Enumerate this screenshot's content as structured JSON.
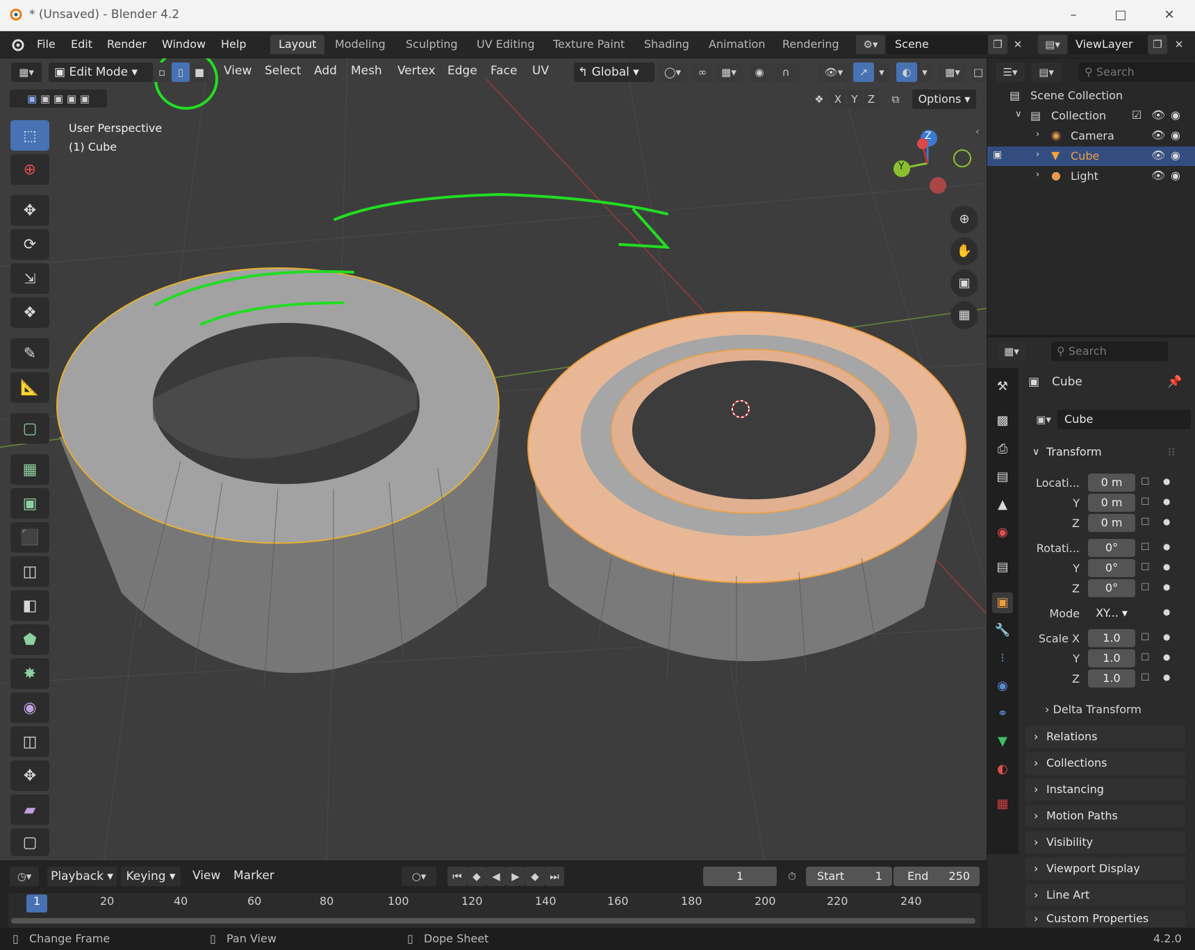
{
  "window": {
    "title": "* (Unsaved) - Blender 4.2",
    "minimize_icon": "minimize-icon",
    "maximize_icon": "maximize-icon",
    "close_icon": "close-icon"
  },
  "topbar": {
    "menus": [
      "File",
      "Edit",
      "Render",
      "Window",
      "Help"
    ],
    "workspaces": [
      "Layout",
      "Modeling",
      "Sculpting",
      "UV Editing",
      "Texture Paint",
      "Shading",
      "Animation",
      "Rendering"
    ],
    "active_workspace": "Layout",
    "scene": "Scene",
    "view_layer": "ViewLayer"
  },
  "viewport": {
    "mode": "Edit Mode",
    "menus": [
      "View",
      "Select",
      "Add",
      "Mesh",
      "Vertex",
      "Edge",
      "Face",
      "UV"
    ],
    "orientation": "Global",
    "axes": [
      "X",
      "Y",
      "Z"
    ],
    "options_label": "Options",
    "overlay_title": "User Perspective",
    "overlay_object": "(1) Cube",
    "gizmo": {
      "z": "Z",
      "y": "Y"
    }
  },
  "outliner": {
    "search_placeholder": "Search",
    "root": "Scene Collection",
    "collection": "Collection",
    "items": [
      "Camera",
      "Cube",
      "Light"
    ],
    "selected": "Cube"
  },
  "properties": {
    "search_placeholder": "Search",
    "object_name": "Cube",
    "datablock": "Cube",
    "transform_header": "Transform",
    "location_label": "Locati...",
    "location": [
      "0 m",
      "0 m",
      "0 m"
    ],
    "rotation_label": "Rotati...",
    "rotation": [
      "0°",
      "0°",
      "0°"
    ],
    "mode_label": "Mode",
    "mode_value": "XY...",
    "scale_label": "Scale X",
    "scale": [
      "1.0",
      "1.0",
      "1.0"
    ],
    "axis_y": "Y",
    "axis_z": "Z",
    "delta_transform": "Delta Transform",
    "panels": [
      "Relations",
      "Collections",
      "Instancing",
      "Motion Paths",
      "Visibility",
      "Viewport Display",
      "Line Art",
      "Custom Properties"
    ]
  },
  "timeline": {
    "menus": [
      "Playback",
      "Keying",
      "View",
      "Marker"
    ],
    "current_frame": "1",
    "start_label": "Start",
    "start": "1",
    "end_label": "End",
    "end": "250",
    "ruler": [
      "1",
      "20",
      "40",
      "60",
      "80",
      "100",
      "120",
      "140",
      "160",
      "180",
      "200",
      "220",
      "240"
    ]
  },
  "statusbar": {
    "items": [
      "Change Frame",
      "Pan View",
      "Dope Sheet"
    ],
    "version": "4.2.0"
  },
  "colors": {
    "accent": "#4772b3",
    "selection_orange": "#f0a040",
    "annotation_green": "#22dd22"
  }
}
